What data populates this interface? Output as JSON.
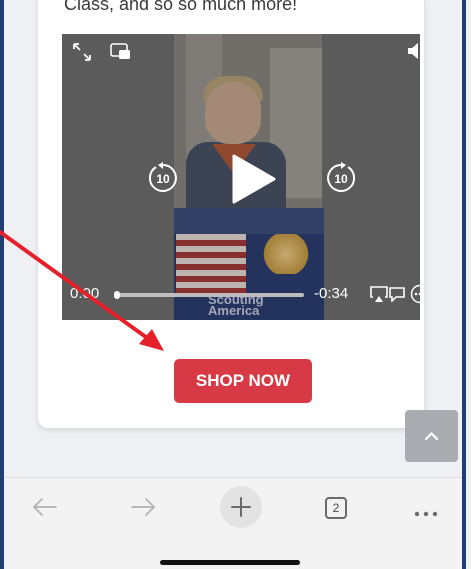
{
  "card": {
    "intro_text": "Class, and so so much more!"
  },
  "video": {
    "book_title": "Scouting America",
    "time_elapsed": "0:00",
    "time_remaining": "-0:34",
    "progress": 0.0,
    "skip_back_seconds": "10",
    "skip_forward_seconds": "10"
  },
  "shop_button": {
    "label": "SHOP NOW",
    "color": "#d73a45"
  },
  "toolbar": {
    "tab_count": "2"
  },
  "icons": [
    "expand-icon",
    "picture-in-picture-icon",
    "volume-icon",
    "skip-back-icon",
    "play-icon",
    "skip-forward-icon",
    "airplay-icon",
    "captions-icon",
    "more-options-icon",
    "chevron-up-icon",
    "back-arrow-icon",
    "forward-arrow-icon",
    "plus-icon",
    "tabs-icon",
    "ellipsis-icon"
  ],
  "annotation": {
    "arrow_color": "#e5202a"
  }
}
